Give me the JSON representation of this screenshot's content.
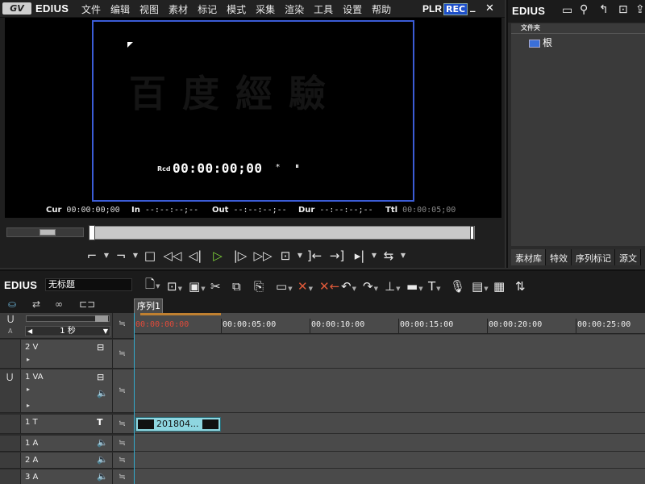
{
  "menubar": {
    "logo": "GV",
    "app_name": "EDIUS",
    "items": [
      "文件",
      "编辑",
      "视图",
      "素材",
      "标记",
      "模式",
      "采集",
      "渲染",
      "工具",
      "设置",
      "帮助"
    ],
    "plr": "PLR",
    "rec": "REC",
    "minimize": "_",
    "close": "✕"
  },
  "monitor": {
    "watermark": "百度經驗",
    "rcd_label": "Rcd",
    "rcd_time": "00:00:00;00",
    "rcd_suffix": "*",
    "pause_icon": "⏸",
    "timecodes": {
      "cur_label": "Cur",
      "cur_value": "00:00:00;00",
      "in_label": "In",
      "in_value": "--:--:--;--",
      "out_label": "Out",
      "out_value": "--:--:--;--",
      "dur_label": "Dur",
      "dur_value": "--:--:--;--",
      "ttl_label": "Ttl",
      "ttl_value": "00:00:05;00"
    }
  },
  "bin": {
    "app_name": "EDIUS",
    "folder_header": "文件夹",
    "root_label": "根",
    "tabs": [
      "素材库",
      "特效",
      "序列标记",
      "源文"
    ]
  },
  "timeline": {
    "app_name": "EDIUS",
    "project_title": "无标题",
    "sequence_tab": "序列1",
    "zoom_label": "1 秒",
    "ruler_labels": [
      "00:00:00:00",
      "00:00:05:00",
      "00:00:10:00",
      "00:00:15:00",
      "00:00:20:00",
      "00:00:25:00"
    ],
    "tracks": [
      {
        "label": "2 V"
      },
      {
        "label": "1 VA"
      },
      {
        "label": "1 T"
      },
      {
        "label": "1 A"
      },
      {
        "label": "2 A"
      },
      {
        "label": "3 A"
      }
    ],
    "clip_label": "201804..."
  },
  "colors": {
    "accent_blue": "#3b5cd6",
    "play_green": "#7fd43a",
    "clip_cyan": "#8ed6e0",
    "rec_blue": "#1d4fc9"
  }
}
